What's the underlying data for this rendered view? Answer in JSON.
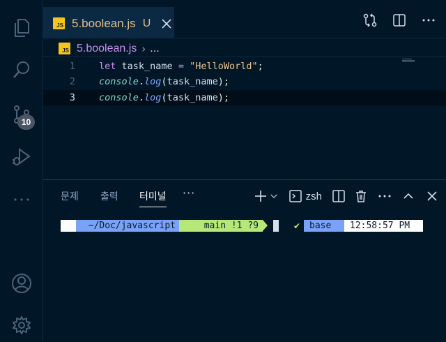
{
  "activity_bar": {
    "items": [
      {
        "name": "explorer",
        "icon": "files-icon"
      },
      {
        "name": "search",
        "icon": "search-icon"
      },
      {
        "name": "source-control",
        "icon": "source-control-icon",
        "badge": "10"
      },
      {
        "name": "run-debug",
        "icon": "run-debug-icon"
      },
      {
        "name": "more",
        "icon": "ellipsis-icon"
      }
    ],
    "bottom": [
      {
        "name": "accounts",
        "icon": "account-icon"
      },
      {
        "name": "manage",
        "icon": "gear-icon"
      }
    ]
  },
  "editor": {
    "tab": {
      "file_icon": "JS",
      "filename": "5.boolean.js",
      "status": "U"
    },
    "actions": [
      "compare-changes-icon",
      "split-editor-icon",
      "more-actions-icon"
    ],
    "breadcrumb": {
      "file_icon": "JS",
      "file": "5.boolean.js",
      "separator": "›",
      "rest": "..."
    },
    "lines": [
      {
        "num": "1"
      },
      {
        "num": "2"
      },
      {
        "num": "3"
      }
    ],
    "code": {
      "line1": {
        "kw": "let",
        "var": "task_name",
        "op": "=",
        "str": "\"HelloWorld\"",
        "end": ";"
      },
      "line2": {
        "obj": "console",
        "dot": ".",
        "fn": "log",
        "open": "(",
        "arg": "task_name",
        "close": ");"
      },
      "line3": {
        "obj": "console",
        "dot": ".",
        "fn": "log",
        "open": "(",
        "arg": "task_name",
        "close": ");"
      }
    },
    "active_line": 3
  },
  "panel": {
    "tabs": [
      {
        "label": "문제",
        "active": false
      },
      {
        "label": "출력",
        "active": false
      },
      {
        "label": "터미널",
        "active": true
      }
    ],
    "more": "···",
    "actions": {
      "add": "plus-icon",
      "dropdown": "chevron-down-icon",
      "shell": "zsh",
      "split": "split-icon",
      "trash": "trash-icon",
      "more": "ellipsis-icon",
      "maximize": "chevron-up-icon",
      "close": "close-icon"
    }
  },
  "terminal": {
    "path": "~/Doc/javascript",
    "git": "main !1 ?9",
    "check": "✔",
    "env": "base",
    "time": "12:58:57 PM"
  },
  "colors": {
    "background": "#011627",
    "tab_active": "#0b2942",
    "modified": "#e2c08d",
    "path_segment": "#7aa2f7",
    "git_segment": "#b6e879"
  }
}
